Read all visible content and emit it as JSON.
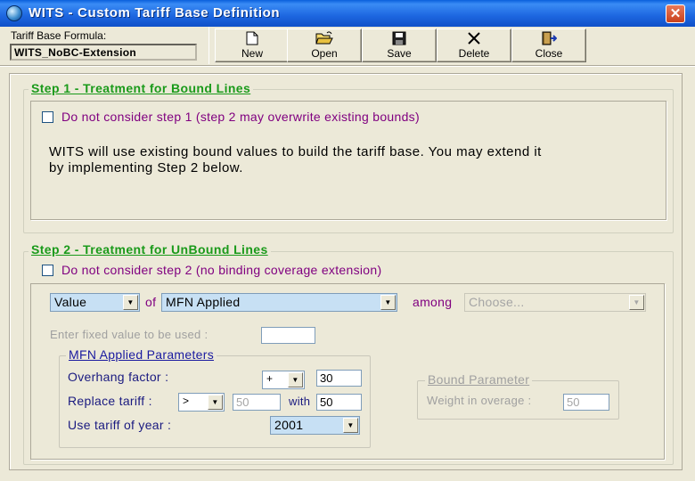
{
  "window": {
    "title": "WITS - Custom Tariff Base Definition",
    "close_glyph": "✕"
  },
  "formula": {
    "label": "Tariff Base Formula:",
    "value": "WITS_NoBC-Extension"
  },
  "toolbar": {
    "new_label": "New",
    "open_label": "Open",
    "save_label": "Save",
    "delete_label": "Delete",
    "close_label": "Close"
  },
  "step1": {
    "title": "Step 1 - Treatment for Bound Lines",
    "checkbox_label": "Do not consider step 1 (step 2 may overwrite existing bounds)",
    "checked": false,
    "description_line1": "WITS will use existing bound values to build the tariff base. You may extend it",
    "description_line2": "by implementing Step 2 below."
  },
  "step2": {
    "title": "Step 2 - Treatment for UnBound Lines",
    "checkbox_label": "Do not consider step 2 (no binding coverage extension)",
    "checked": false,
    "value_select": "Value",
    "of_label": "of",
    "source_select": "MFN Applied",
    "among_label": "among",
    "among_select": "Choose...",
    "fixed_value_label": "Enter fixed value to be used :",
    "fixed_value": "",
    "mfn_params": {
      "title": "MFN Applied Parameters",
      "overhang_label": "Overhang factor :",
      "overhang_operator": "+",
      "overhang_value": "30",
      "replace_label": "Replace tariff :",
      "replace_operator": ">",
      "replace_threshold": "50",
      "with_label": "with",
      "replace_with": "50",
      "year_label": "Use tariff of year :",
      "year_value": "2001"
    },
    "bound_params": {
      "title": "Bound Parameter",
      "weight_label": "Weight in overage :",
      "weight_value": "50"
    }
  },
  "colors": {
    "title_bar": "#0a5fdc",
    "step_title": "#1a9a1a",
    "checkbox_text": "#800080",
    "combo_bg": "#c7e0f4"
  },
  "icons": [
    "globe-icon",
    "new-document-icon",
    "open-folder-icon",
    "floppy-disk-icon",
    "delete-x-icon",
    "exit-door-icon"
  ]
}
